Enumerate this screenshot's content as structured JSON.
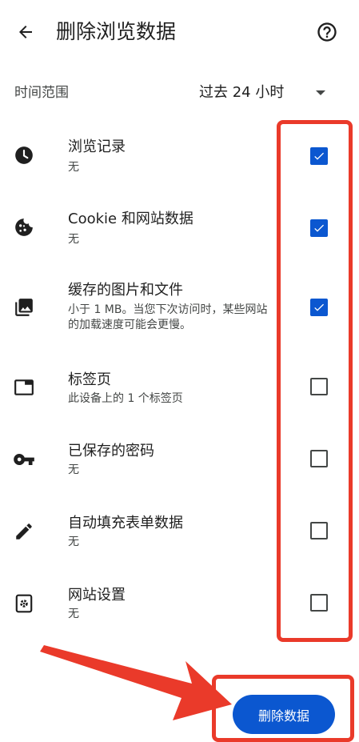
{
  "header": {
    "title": "删除浏览数据",
    "back_icon": "arrow-back-icon",
    "help_icon": "help-circle-icon"
  },
  "time_range": {
    "label": "时间范围",
    "selected": "过去 24 小时"
  },
  "items": [
    {
      "icon": "clock-icon",
      "title": "浏览记录",
      "subtitle": "无",
      "checked": true
    },
    {
      "icon": "cookie-icon",
      "title": "Cookie 和网站数据",
      "subtitle": "无",
      "checked": true
    },
    {
      "icon": "image-icon",
      "title": "缓存的图片和文件",
      "subtitle": "小于 1 MB。当您下次访问时，某些网站的加载速度可能会更慢。",
      "checked": true
    },
    {
      "icon": "tab-icon",
      "title": "标签页",
      "subtitle": "此设备上的 1 个标签页",
      "checked": false
    },
    {
      "icon": "key-icon",
      "title": "已保存的密码",
      "subtitle": "无",
      "checked": false
    },
    {
      "icon": "pencil-icon",
      "title": "自动填充表单数据",
      "subtitle": "无",
      "checked": false
    },
    {
      "icon": "site-settings-icon",
      "title": "网站设置",
      "subtitle": "无",
      "checked": false
    }
  ],
  "delete_button": {
    "label": "删除数据"
  },
  "colors": {
    "accent": "#0b57d0",
    "annotation_red": "#ea3a2a",
    "text_primary": "#1f1f1f",
    "text_secondary": "#444746"
  }
}
